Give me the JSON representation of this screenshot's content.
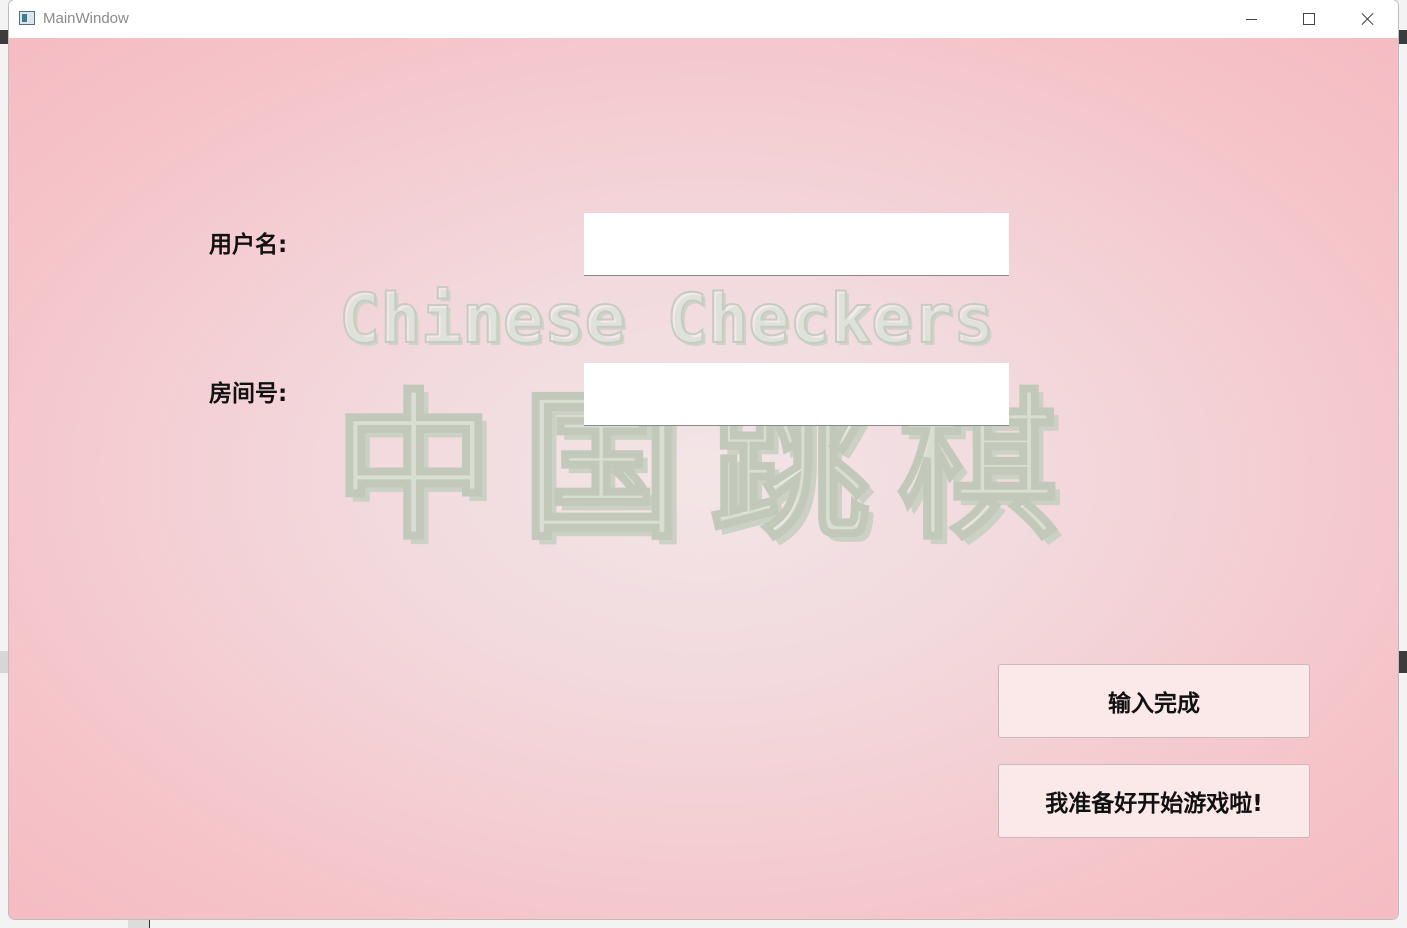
{
  "window": {
    "title": "MainWindow"
  },
  "watermark": {
    "english": "Chinese Checkers",
    "chinese": "中国跳棋"
  },
  "form": {
    "username_label": "用户名:",
    "username_value": "",
    "room_label": "房间号:",
    "room_value": ""
  },
  "buttons": {
    "done_label": "输入完成",
    "ready_label": "我准备好开始游戏啦!"
  },
  "colors": {
    "background_center": "#f3e5e7",
    "background_edge": "#f5bcc2",
    "button_fill": "#fbe9ea",
    "watermark": "#c6cdc0"
  },
  "icons": {
    "app": "app-window-icon",
    "minimize": "minimize-icon",
    "maximize": "maximize-icon",
    "close": "close-icon"
  }
}
